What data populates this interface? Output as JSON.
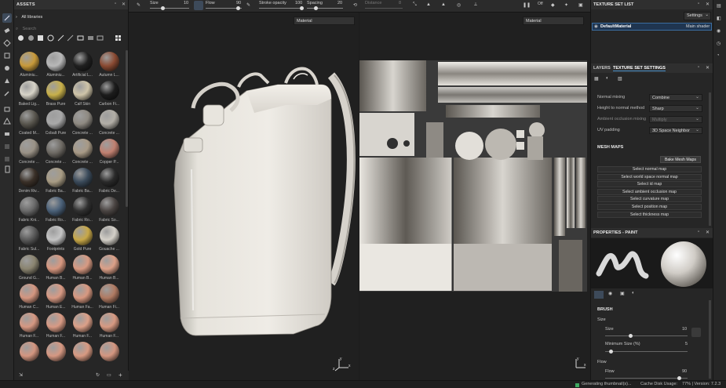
{
  "assets": {
    "title": "ASSETS",
    "library": "All libraries",
    "search_placeholder": "Search",
    "items": [
      {
        "label": "Aluminiu...",
        "color": "#c89a3a"
      },
      {
        "label": "Aluminiu...",
        "color": "#b8b8b8"
      },
      {
        "label": "Artificial L...",
        "color": "#202020"
      },
      {
        "label": "Autumn L...",
        "color": "#8a4a32"
      },
      {
        "label": "Baked Lig...",
        "color": "#d8d4c8"
      },
      {
        "label": "Brass Pure",
        "color": "#c8b04a"
      },
      {
        "label": "Calf Skin",
        "color": "#cfc4a8"
      },
      {
        "label": "Carbon Fi...",
        "color": "#1c1c1c"
      },
      {
        "label": "Coated M...",
        "color": "#5a574f"
      },
      {
        "label": "Cobalt Pure",
        "color": "#a8a8a8"
      },
      {
        "label": "Concrete ...",
        "color": "#8f8a82"
      },
      {
        "label": "Concrete ...",
        "color": "#b2aea6"
      },
      {
        "label": "Concrete ...",
        "color": "#9a9286"
      },
      {
        "label": "Concrete ...",
        "color": "#6e6a64"
      },
      {
        "label": "Concrete ...",
        "color": "#a89a86"
      },
      {
        "label": "Copper P...",
        "color": "#c08070"
      },
      {
        "label": "Denim Riv...",
        "color": "#3a3028"
      },
      {
        "label": "Fabric Ba...",
        "color": "#a89c84"
      },
      {
        "label": "Fabric Ba...",
        "color": "#3a4a5a"
      },
      {
        "label": "Fabric De...",
        "color": "#2a2a2a"
      },
      {
        "label": "Fabric Kni...",
        "color": "#6a6a6a"
      },
      {
        "label": "Fabric Ro...",
        "color": "#4a6078"
      },
      {
        "label": "Fabric Ro...",
        "color": "#303030"
      },
      {
        "label": "Fabric So...",
        "color": "#4a4442"
      },
      {
        "label": "Fabric Sul...",
        "color": "#5a5a5a"
      },
      {
        "label": "Footprints",
        "color": "#c4c4c4"
      },
      {
        "label": "Gold Pure",
        "color": "#c8a848"
      },
      {
        "label": "Gouache ...",
        "color": "#d4d0c8"
      },
      {
        "label": "Ground G...",
        "color": "#8a8470"
      },
      {
        "label": "Human B...",
        "color": "#d89880"
      },
      {
        "label": "Human B...",
        "color": "#d89a82"
      },
      {
        "label": "Human B...",
        "color": "#dca088"
      },
      {
        "label": "Human C...",
        "color": "#d49680"
      },
      {
        "label": "Human E...",
        "color": "#d89a84"
      },
      {
        "label": "Human Fa...",
        "color": "#d89880"
      },
      {
        "label": "Human Fi...",
        "color": "#b07a62"
      },
      {
        "label": "Human F...",
        "color": "#d69882"
      },
      {
        "label": "Human F...",
        "color": "#d89a84"
      },
      {
        "label": "Human F...",
        "color": "#dca088"
      },
      {
        "label": "Human F...",
        "color": "#d89a82"
      },
      {
        "label": "",
        "color": "#d49680"
      },
      {
        "label": "",
        "color": "#d69882"
      },
      {
        "label": "",
        "color": "#d89a82"
      },
      {
        "label": "",
        "color": "#d49680"
      }
    ]
  },
  "toolbar": {
    "size_label": "Size",
    "size_value": "10",
    "flow_label": "Flow",
    "flow_value": "90",
    "stroke_opacity_label": "Stroke opacity",
    "stroke_opacity_value": "100",
    "spacing_label": "Spacing",
    "spacing_value": "20",
    "distance_label": "Distance",
    "distance_value": "8",
    "mode_label": "Off"
  },
  "viewport3d": {
    "material_select": "Material"
  },
  "viewport2d": {
    "material_select": "Material"
  },
  "texture_set_list": {
    "title": "TEXTURE SET LIST",
    "settings_label": "Settings",
    "item_name": "DefaultMaterial",
    "item_shader": "Main shader"
  },
  "texture_settings": {
    "tab_layers": "LAYERS",
    "tab_settings": "TEXTURE SET SETTINGS",
    "rows": [
      {
        "label": "Normal mixing",
        "value": "Combine"
      },
      {
        "label": "Height to normal method",
        "value": "Sharp"
      },
      {
        "label": "Ambient occlusion mixing",
        "value": "Multiply"
      },
      {
        "label": "UV padding",
        "value": "3D Space Neighbor"
      }
    ],
    "mesh_maps_title": "MESH MAPS",
    "bake_button": "Bake Mesh Maps",
    "maps": [
      "Select normal map",
      "Select world space normal map",
      "Select id map",
      "Select ambient occlusion map",
      "Select curvature map",
      "Select position map",
      "Select thickness map"
    ]
  },
  "properties": {
    "title": "PROPERTIES - PAINT",
    "brush_title": "BRUSH",
    "size_group": "Size",
    "size_label": "Size",
    "size_value": "10",
    "min_size_label": "Minimum Size (%)",
    "min_size_value": "5",
    "flow_group": "Flow",
    "flow_label": "Flow",
    "flow_value": "90"
  },
  "status": {
    "message": "Generating thumbnail(s)...",
    "cache": "Cache Disk Usage:",
    "cache_value": "77% | Version: 7.2.3"
  },
  "colors": {
    "accent": "#4a90c8",
    "selection": "#1f3550",
    "highlight": "#7ab5e8"
  }
}
